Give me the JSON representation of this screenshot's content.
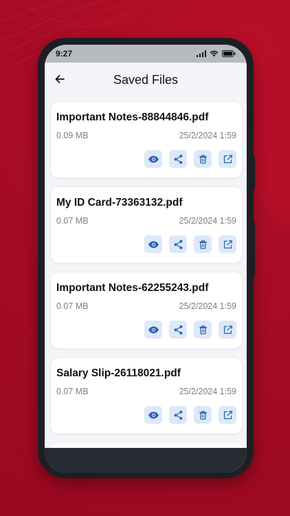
{
  "status": {
    "time": "9:27"
  },
  "header": {
    "title": "Saved Files"
  },
  "files": [
    {
      "name": "Important Notes-88844846.pdf",
      "size": "0.09 MB",
      "date": "25/2/2024 1:59"
    },
    {
      "name": "My ID Card-73363132.pdf",
      "size": "0.07 MB",
      "date": "25/2/2024 1:59"
    },
    {
      "name": "Important Notes-62255243.pdf",
      "size": "0.07 MB",
      "date": "25/2/2024 1:59"
    },
    {
      "name": "Salary Slip-26118021.pdf",
      "size": "0.07 MB",
      "date": "25/2/2024 1:59"
    }
  ],
  "icons": {
    "back": "arrow-left-icon",
    "actions": [
      "eye-icon",
      "share-icon",
      "trash-icon",
      "open-external-icon"
    ]
  },
  "colors": {
    "background": "#a70c24",
    "accent": "#2b63b5",
    "action_bg": "#dde8f8"
  }
}
